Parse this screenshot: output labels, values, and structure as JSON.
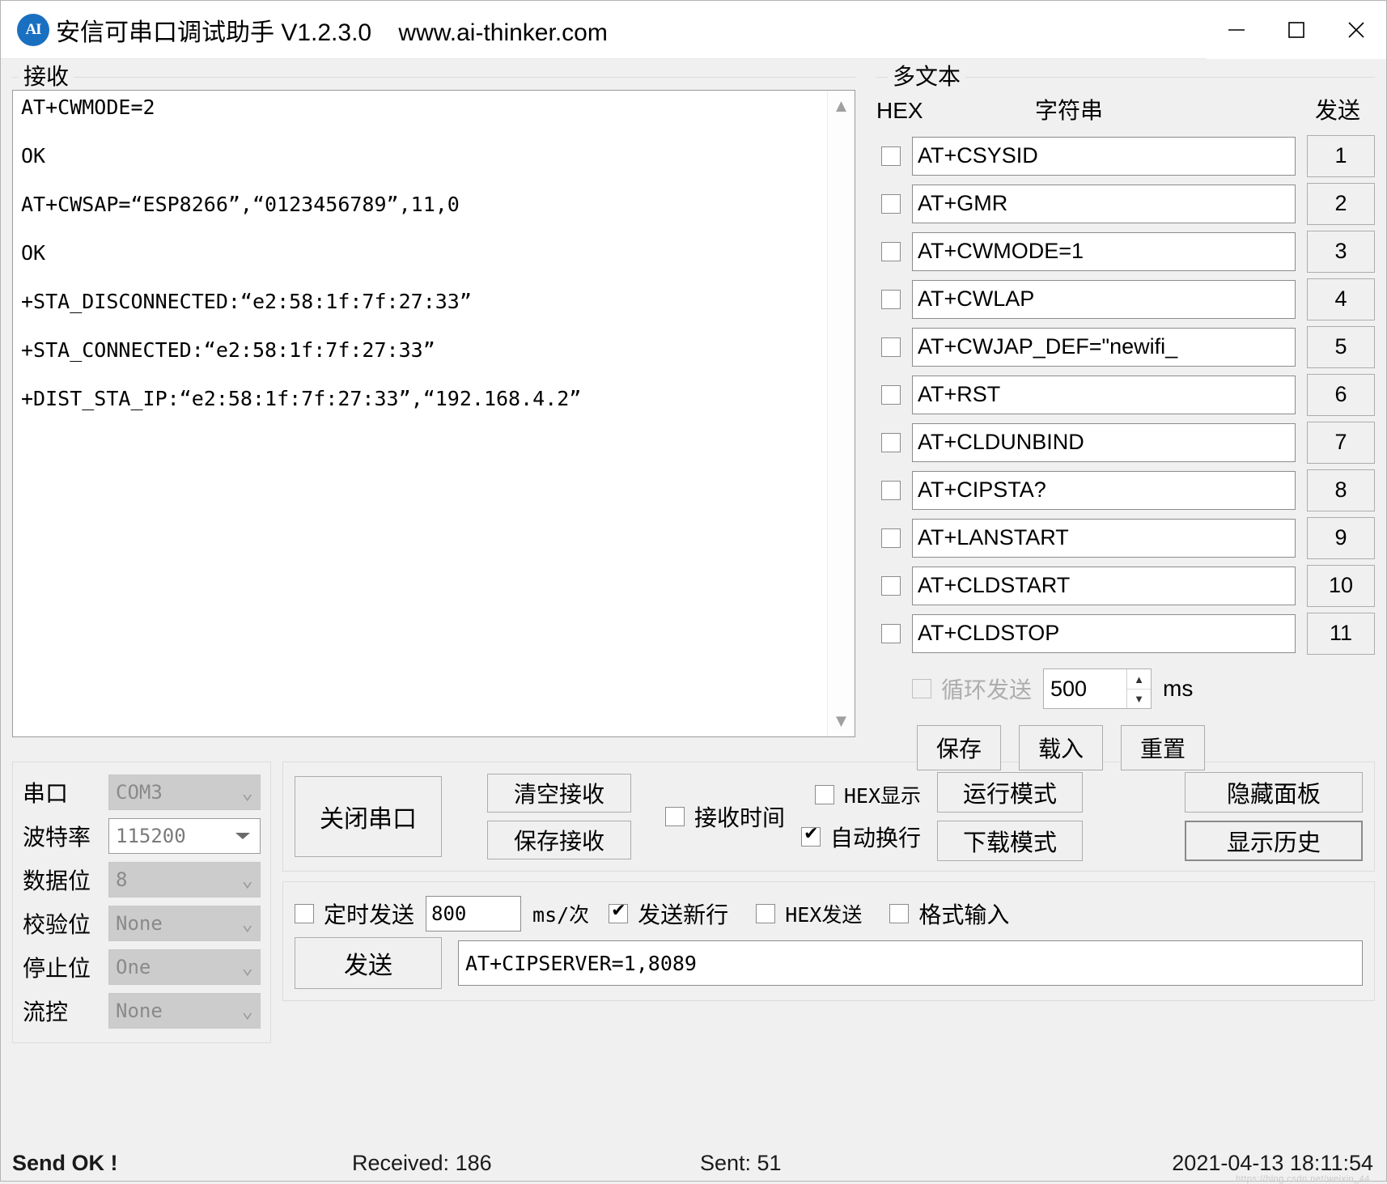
{
  "window": {
    "logo_text": "AI",
    "title": "安信可串口调试助手 V1.2.3.0    www.ai-thinker.com",
    "minimize_label": "minimize",
    "maximize_label": "maximize",
    "close_label": "close"
  },
  "receive": {
    "legend": "接收",
    "text": "AT+CWMODE=2\n\nOK\n\nAT+CWSAP=“ESP8266”,“0123456789”,11,0\n\nOK\n\n+STA_DISCONNECTED:“e2:58:1f:7f:27:33”\n\n+STA_CONNECTED:“e2:58:1f:7f:27:33”\n\n+DIST_STA_IP:“e2:58:1f:7f:27:33”,“192.168.4.2”\n",
    "scroll_up": "▲",
    "scroll_down": "▼"
  },
  "multitext": {
    "legend": "多文本",
    "header": {
      "hex": "HEX",
      "string": "字符串",
      "send": "发送"
    },
    "rows": [
      {
        "checked": false,
        "command": "AT+CSYSID",
        "send_label": "1"
      },
      {
        "checked": false,
        "command": "AT+GMR",
        "send_label": "2"
      },
      {
        "checked": false,
        "command": "AT+CWMODE=1",
        "send_label": "3"
      },
      {
        "checked": false,
        "command": "AT+CWLAP",
        "send_label": "4"
      },
      {
        "checked": false,
        "command": "AT+CWJAP_DEF=\"newifi_",
        "send_label": "5"
      },
      {
        "checked": false,
        "command": "AT+RST",
        "send_label": "6"
      },
      {
        "checked": false,
        "command": "AT+CLDUNBIND",
        "send_label": "7"
      },
      {
        "checked": false,
        "command": "AT+CIPSTA?",
        "send_label": "8"
      },
      {
        "checked": false,
        "command": "AT+LANSTART",
        "send_label": "9"
      },
      {
        "checked": false,
        "command": "AT+CLDSTART",
        "send_label": "10"
      },
      {
        "checked": false,
        "command": "AT+CLDSTOP",
        "send_label": "11"
      }
    ],
    "loop": {
      "checked": false,
      "label": "循环发送",
      "interval": "500",
      "unit": "ms",
      "spin_up": "▲",
      "spin_down": "▼"
    },
    "buttons": {
      "save": "保存",
      "load": "载入",
      "reset": "重置"
    }
  },
  "serial": {
    "rows": [
      {
        "label": "串口",
        "value": "COM3",
        "enabled": false
      },
      {
        "label": "波特率",
        "value": "115200",
        "enabled": true
      },
      {
        "label": "数据位",
        "value": "8",
        "enabled": false
      },
      {
        "label": "校验位",
        "value": "None",
        "enabled": false
      },
      {
        "label": "停止位",
        "value": "One",
        "enabled": false
      },
      {
        "label": "流控",
        "value": "None",
        "enabled": false
      }
    ]
  },
  "controls": {
    "toggle_port": "关闭串口",
    "clear_recv": "清空接收",
    "save_recv": "保存接收",
    "recv_time": {
      "label": "接收时间",
      "checked": false
    },
    "hex_display": {
      "label": "HEX显示",
      "checked": false
    },
    "auto_wrap": {
      "label": "自动换行",
      "checked": true
    },
    "run_mode": "运行模式",
    "download_mode": "下载模式",
    "hide_panel": "隐藏面板",
    "show_history": "显示历史"
  },
  "send": {
    "timed": {
      "label": "定时发送",
      "checked": false
    },
    "interval": "800",
    "interval_unit": "ms/次",
    "send_newline": {
      "label": "发送新行",
      "checked": true
    },
    "hex_send": {
      "label": "HEX发送",
      "checked": false
    },
    "format_input": {
      "label": "格式输入",
      "checked": false
    },
    "send_button": "发送",
    "send_value": "AT+CIPSERVER=1,8089"
  },
  "status": {
    "send_state": "Send OK !",
    "received": "Received: 186",
    "sent": "Sent: 51",
    "timestamp": "2021-04-13 18:11:54",
    "watermark": "https://blog.csdn.net/weixin_44"
  }
}
